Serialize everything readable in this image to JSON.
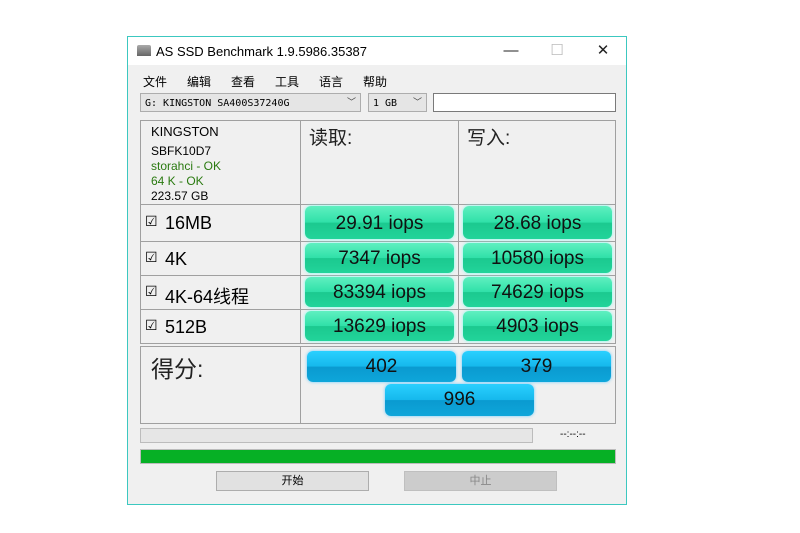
{
  "window": {
    "title": "AS SSD Benchmark 1.9.5986.35387",
    "minimize": "—",
    "maximize": "☐",
    "close": "✕"
  },
  "menu": [
    "文件",
    "编辑",
    "查看",
    "工具",
    "语言",
    "帮助"
  ],
  "drive_select": "G: KINGSTON SA400S37240G",
  "size_select": "1 GB",
  "text_field": "",
  "info": {
    "vendor": "KINGSTON",
    "firmware": "SBFK10D7",
    "driver": "storahci - OK",
    "align": "64 K - OK",
    "capacity": "223.57 GB"
  },
  "headers": {
    "read": "读取:",
    "write": "写入:"
  },
  "rows": [
    {
      "check": "☑",
      "label": "16MB",
      "read": "29.91 iops",
      "write": "28.68 iops"
    },
    {
      "check": "☑",
      "label": "4K",
      "read": "7347 iops",
      "write": "10580 iops"
    },
    {
      "check": "☑",
      "label": "4K-64线程",
      "read": "83394 iops",
      "write": "74629 iops"
    },
    {
      "check": "☑",
      "label": "512B",
      "read": "13629 iops",
      "write": "4903 iops"
    }
  ],
  "score": {
    "label": "得分:",
    "read": "402",
    "write": "379",
    "total": "996"
  },
  "progress": {
    "time": "--:--:--",
    "value": 0
  },
  "total_progress": 1.0,
  "buttons": {
    "start": "开始",
    "stop": "中止"
  }
}
